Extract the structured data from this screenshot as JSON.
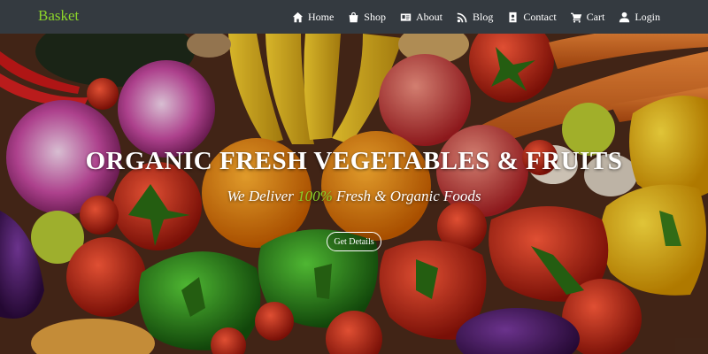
{
  "brand": {
    "name": "Basket",
    "color": "#8bd32a"
  },
  "nav": {
    "items": [
      {
        "label": "Home",
        "icon": "home-icon"
      },
      {
        "label": "Shop",
        "icon": "shopping-bag-icon"
      },
      {
        "label": "About",
        "icon": "id-card-icon"
      },
      {
        "label": "Blog",
        "icon": "rss-icon"
      },
      {
        "label": "Contact",
        "icon": "address-book-icon"
      },
      {
        "label": "Cart",
        "icon": "cart-icon"
      },
      {
        "label": "Login",
        "icon": "user-icon"
      }
    ]
  },
  "hero": {
    "title": "ORGANIC FRESH VEGETABLES & FRUITS",
    "subtitle_before": "We Deliver ",
    "subtitle_accent": "100%",
    "subtitle_after": " Fresh & Organic Foods",
    "button_label": "Get Details",
    "background": "vegetables-and-fruits-photo"
  }
}
